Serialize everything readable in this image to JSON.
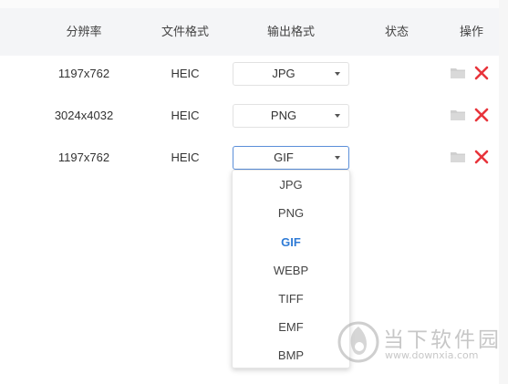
{
  "table": {
    "headers": {
      "resolution": "分辨率",
      "file_format": "文件格式",
      "output_format": "输出格式",
      "status": "状态",
      "actions": "操作"
    },
    "rows": [
      {
        "resolution": "1197x762",
        "file_format": "HEIC",
        "output_format": "JPG",
        "status": ""
      },
      {
        "resolution": "3024x4032",
        "file_format": "HEIC",
        "output_format": "PNG",
        "status": ""
      },
      {
        "resolution": "1197x762",
        "file_format": "HEIC",
        "output_format": "GIF",
        "status": ""
      }
    ]
  },
  "dropdown": {
    "options": [
      "JPG",
      "PNG",
      "GIF",
      "WEBP",
      "TIFF",
      "EMF",
      "BMP"
    ],
    "selected": "GIF"
  },
  "watermark": {
    "brand": "当下软件园",
    "url": "www.downxia.com"
  },
  "colors": {
    "header_bg": "#f4f5f7",
    "selected_option": "#2f7bd6",
    "delete_icon": "#e8343b",
    "active_border": "#5b8fd9"
  }
}
